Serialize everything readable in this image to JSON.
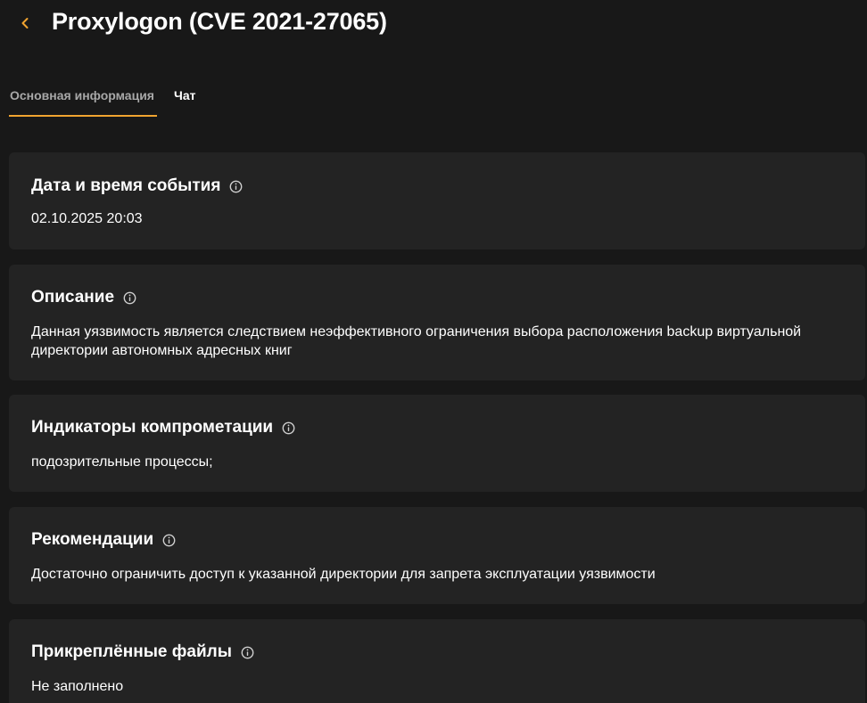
{
  "header": {
    "title": "Proxylogon (CVE 2021-27065)",
    "back_icon": "chevron-left-icon",
    "accent_color": "#f0a330"
  },
  "tabs": [
    {
      "label": "Основная информация",
      "active": true
    },
    {
      "label": "Чат",
      "active": false
    }
  ],
  "sections": {
    "date": {
      "title": "Дата и время события",
      "value": "02.10.2025 20:03"
    },
    "description": {
      "title": "Описание",
      "value": "Данная уязвимость является следствием неэффективного ограничения выбора расположения backup виртуальной директории автономных адресных книг"
    },
    "indicators": {
      "title": "Индикаторы компрометации",
      "value": "подозрительные процессы;"
    },
    "recommendations": {
      "title": "Рекомендации",
      "value": "Достаточно ограничить доступ к указанной директории для запрета эксплуатации уязвимости"
    },
    "files": {
      "title": "Прикреплённые файлы",
      "value": "Не заполнено"
    }
  }
}
